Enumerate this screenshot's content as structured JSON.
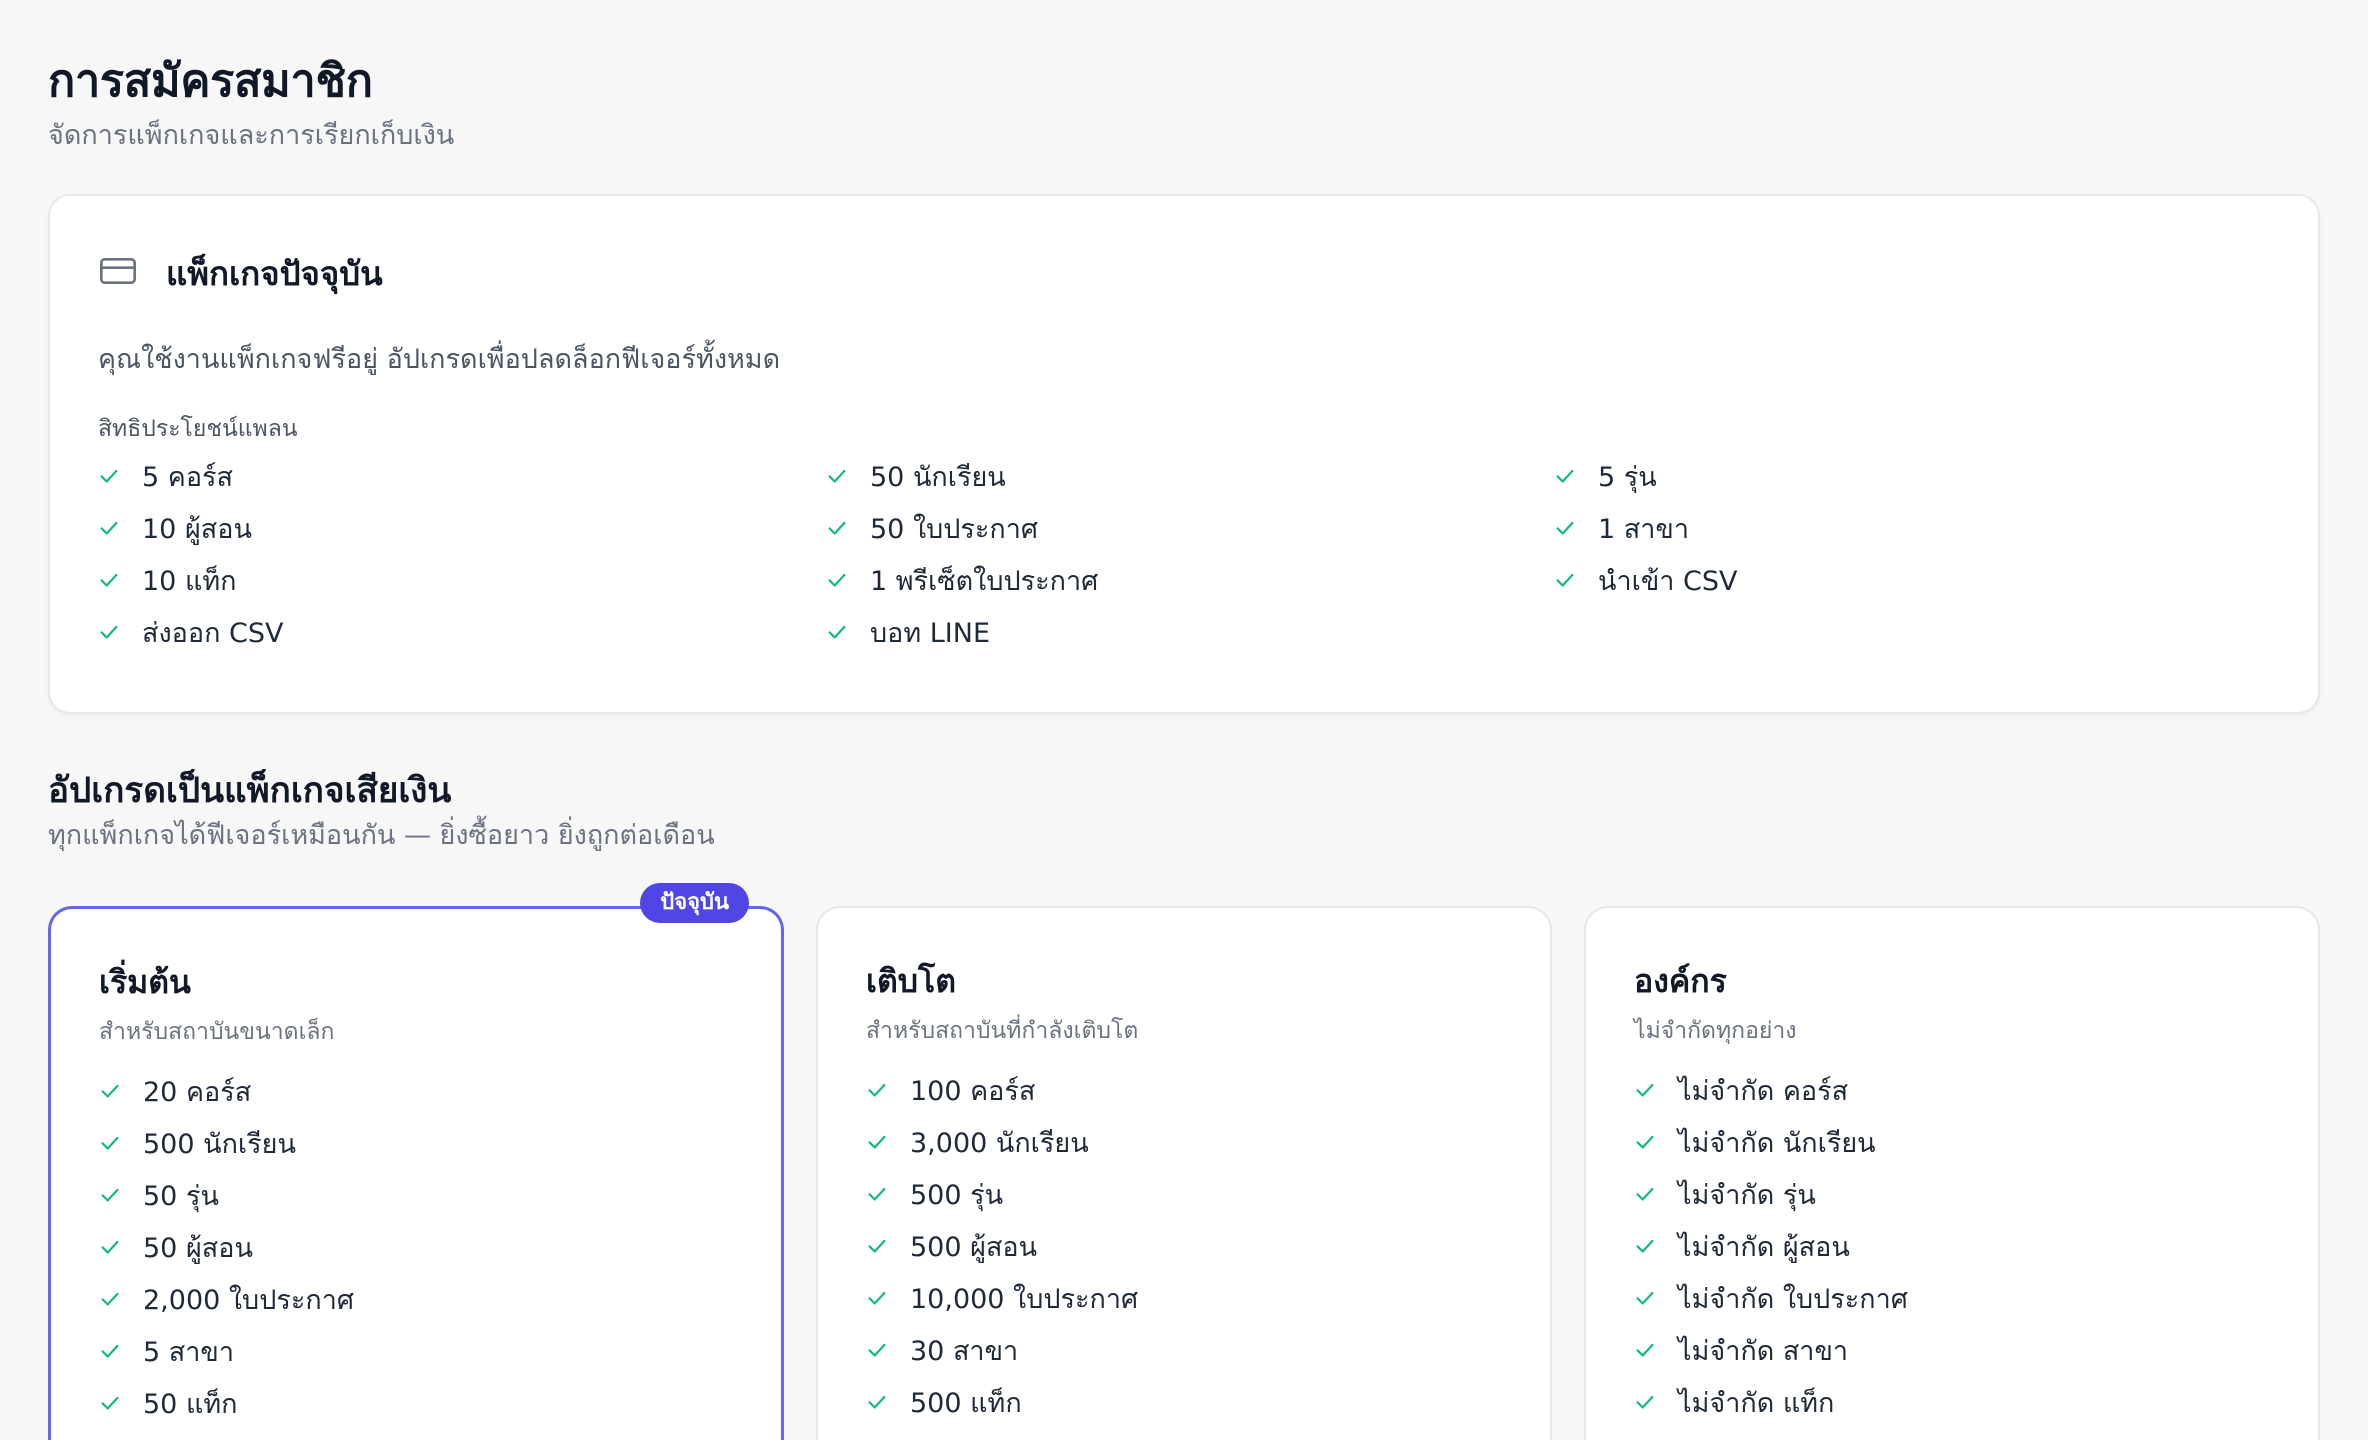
{
  "header": {
    "title": "การสมัครสมาชิก",
    "subtitle": "จัดการแพ็กเกจและการเรียกเก็บเงิน"
  },
  "current_package": {
    "title": "แพ็กเกจปัจจุบัน",
    "icon": "credit-card-icon",
    "description": "คุณใช้งานแพ็กเกจฟรีอยู่ อัปเกรดเพื่อปลดล็อกฟีเจอร์ทั้งหมด",
    "benefits_label": "สิทธิประโยชน์แพลน",
    "benefits": [
      "5 คอร์ส",
      "50 นักเรียน",
      "5 รุ่น",
      "10 ผู้สอน",
      "50 ใบประกาศ",
      "1 สาขา",
      "10 แท็ก",
      "1 พรีเซ็ตใบประกาศ",
      "นำเข้า CSV",
      "ส่งออก CSV",
      "บอท LINE"
    ]
  },
  "upgrade": {
    "title": "อัปเกรดเป็นแพ็กเกจเสียเงิน",
    "subtitle": "ทุกแพ็กเกจได้ฟีเจอร์เหมือนกัน — ยิ่งซื้อยาว ยิ่งถูกต่อเดือน"
  },
  "plans": [
    {
      "name": "เริ่มต้น",
      "description": "สำหรับสถาบันขนาดเล็ก",
      "badge": "ปัจจุบัน",
      "features": [
        "20 คอร์ส",
        "500 นักเรียน",
        "50 รุ่น",
        "50 ผู้สอน",
        "2,000 ใบประกาศ",
        "5 สาขา",
        "50 แท็ก"
      ]
    },
    {
      "name": "เติบโต",
      "description": "สำหรับสถาบันที่กำลังเติบโต",
      "features": [
        "100 คอร์ส",
        "3,000 นักเรียน",
        "500 รุ่น",
        "500 ผู้สอน",
        "10,000 ใบประกาศ",
        "30 สาขา",
        "500 แท็ก"
      ]
    },
    {
      "name": "องค์กร",
      "description": "ไม่จำกัดทุกอย่าง",
      "features": [
        "ไม่จำกัด คอร์ส",
        "ไม่จำกัด นักเรียน",
        "ไม่จำกัด รุ่น",
        "ไม่จำกัด ผู้สอน",
        "ไม่จำกัด ใบประกาศ",
        "ไม่จำกัด สาขา",
        "ไม่จำกัด แท็ก"
      ]
    }
  ],
  "colors": {
    "accent": "#4f46e5",
    "check": "#10b981"
  }
}
